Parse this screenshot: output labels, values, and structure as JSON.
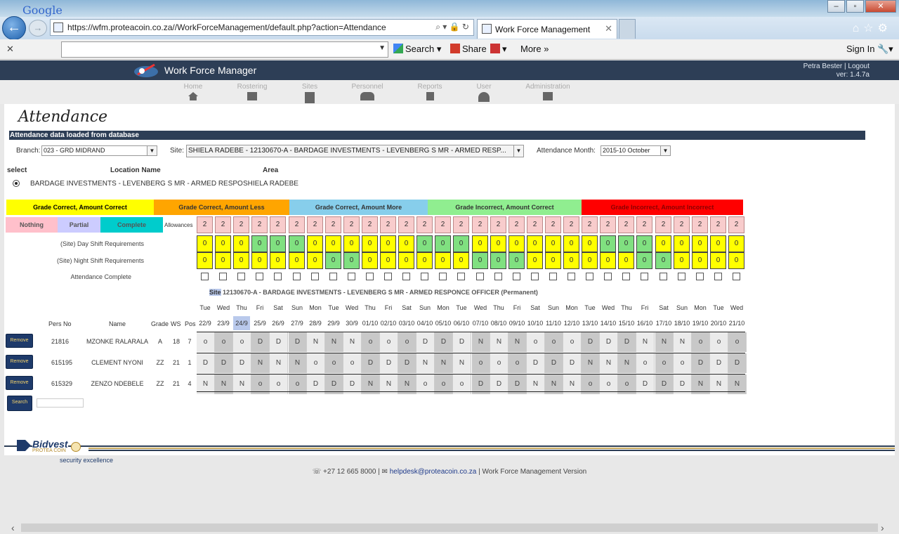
{
  "browser": {
    "url": "https://wfm.proteacoin.co.za//WorkForceManagement/default.php?action=Attendance",
    "tab_title": "Work Force Management"
  },
  "google_bar": {
    "logo": "Google",
    "search_label": "Search",
    "share_label": "Share",
    "more_label": "More",
    "signin_label": "Sign In"
  },
  "app": {
    "title": "Work Force Manager",
    "user_text": "Petra Bester | Logout",
    "version": "ver: 1.4.7a"
  },
  "menu": [
    "Home",
    "Rostering",
    "Sites",
    "Personnel",
    "Reports",
    "User",
    "Administration"
  ],
  "page": {
    "title": "Attendance",
    "status": "Attendance data loaded from database"
  },
  "filters": {
    "branch_label": "Branch:",
    "branch_value": "023 - GRD MIDRAND",
    "site_label": "Site:",
    "site_value": "SHIELA RADEBE - 12130670-A - BARDAGE INVESTMENTS - LEVENBERG S MR - ARMED RESP...",
    "month_label": "Attendance Month:",
    "month_value": "2015-10 October"
  },
  "location_table": {
    "headers": [
      "select",
      "Location Name",
      "Area"
    ],
    "location_name": "BARDAGE INVESTMENTS - LEVENBERG S MR - ARMED RESPO",
    "area": "SHIELA RADEBE"
  },
  "legend": [
    {
      "label": "Grade Correct, Amount Correct",
      "color": "#ffff00",
      "text_color": "#000000"
    },
    {
      "label": "Grade Correct, Amount Less",
      "color": "#ffa500",
      "text_color": "#333333"
    },
    {
      "label": "Grade Correct, Amount More",
      "color": "#87ceeb",
      "text_color": "#333333"
    },
    {
      "label": "Grade Incorrect, Amount Correct",
      "color": "#90ee90",
      "text_color": "#333333"
    },
    {
      "label": "Grade Incorrect, Amount Incorrect",
      "color": "#ff0000",
      "text_color": "#8b0000"
    }
  ],
  "legend2": [
    {
      "label": "Nothing",
      "color": "#ffc0cb"
    },
    {
      "label": "Partial",
      "color": "#ccccff"
    },
    {
      "label": "Complete",
      "color": "#00cccc"
    }
  ],
  "requirement_rows": {
    "allowances_label": "Allowances",
    "day_label": "(Site) Day Shift Requirements",
    "night_label": "(Site) Night Shift Requirements",
    "complete_label": "Attendance Complete"
  },
  "allowances": [
    "2",
    "2",
    "2",
    "2",
    "2",
    "2",
    "2",
    "2",
    "2",
    "2",
    "2",
    "2",
    "2",
    "2",
    "2",
    "2",
    "2",
    "2",
    "2",
    "2",
    "2",
    "2",
    "2",
    "2",
    "2",
    "2",
    "2",
    "2",
    "2",
    "2"
  ],
  "day_req": [
    "0",
    "0",
    "0",
    "0",
    "0",
    "0",
    "0",
    "0",
    "0",
    "0",
    "0",
    "0",
    "0",
    "0",
    "0",
    "0",
    "0",
    "0",
    "0",
    "0",
    "0",
    "0",
    "0",
    "0",
    "0",
    "0",
    "0",
    "0",
    "0",
    "0"
  ],
  "day_colors": [
    "y",
    "y",
    "y",
    "g",
    "g",
    "g",
    "y",
    "y",
    "y",
    "y",
    "y",
    "y",
    "g",
    "g",
    "g",
    "y",
    "y",
    "y",
    "y",
    "y",
    "y",
    "y",
    "g",
    "g",
    "g",
    "y",
    "y",
    "y",
    "y",
    "y"
  ],
  "night_req": [
    "0",
    "0",
    "0",
    "0",
    "0",
    "0",
    "0",
    "0",
    "0",
    "0",
    "0",
    "0",
    "0",
    "0",
    "0",
    "0",
    "0",
    "0",
    "0",
    "0",
    "0",
    "0",
    "0",
    "0",
    "0",
    "0",
    "0",
    "0",
    "0",
    "0"
  ],
  "night_colors": [
    "y",
    "y",
    "y",
    "y",
    "y",
    "y",
    "y",
    "g",
    "g",
    "y",
    "y",
    "y",
    "y",
    "y",
    "y",
    "g",
    "g",
    "g",
    "y",
    "y",
    "y",
    "y",
    "y",
    "y",
    "g",
    "g",
    "y",
    "y",
    "y",
    "y"
  ],
  "site_heading": {
    "prefix": "Site",
    "text": "12130670-A - BARDAGE INVESTMENTS - LEVENBERG S MR - ARMED RESPONCE OFFICER (Permanent)"
  },
  "days": [
    "Tue",
    "Wed",
    "Thu",
    "Fri",
    "Sat",
    "Sun",
    "Mon",
    "Tue",
    "Wed",
    "Thu",
    "Fri",
    "Sat",
    "Sun",
    "Mon",
    "Tue",
    "Wed",
    "Thu",
    "Fri",
    "Sat",
    "Sun",
    "Mon",
    "Tue",
    "Wed",
    "Thu",
    "Fri",
    "Sat",
    "Sun",
    "Mon",
    "Tue",
    "Wed"
  ],
  "dates": [
    "22/9",
    "23/9",
    "24/9",
    "25/9",
    "26/9",
    "27/9",
    "28/9",
    "29/9",
    "30/9",
    "01/10",
    "02/10",
    "03/10",
    "04/10",
    "05/10",
    "06/10",
    "07/10",
    "08/10",
    "09/10",
    "10/10",
    "11/10",
    "12/10",
    "13/10",
    "14/10",
    "15/10",
    "16/10",
    "17/10",
    "18/10",
    "19/10",
    "20/10",
    "21/10"
  ],
  "personnel_headers": {
    "pers_no": "Pers No",
    "name": "Name",
    "grade": "Grade",
    "ws": "WS",
    "pos": "Pos"
  },
  "personnel": [
    {
      "pers_no": "21816",
      "name": "MZONKE RALARALA",
      "grade": "A",
      "ws": "18",
      "pos": "7",
      "shifts": [
        "o",
        "o",
        "o",
        "D",
        "D",
        "D",
        "N",
        "N",
        "N",
        "o",
        "o",
        "o",
        "D",
        "D",
        "D",
        "N",
        "N",
        "N",
        "o",
        "o",
        "o",
        "D",
        "D",
        "D",
        "N",
        "N",
        "N",
        "o",
        "o",
        "o"
      ]
    },
    {
      "pers_no": "615195",
      "name": "CLEMENT NYONI",
      "grade": "ZZ",
      "ws": "21",
      "pos": "1",
      "shifts": [
        "D",
        "D",
        "D",
        "N",
        "N",
        "N",
        "o",
        "o",
        "o",
        "D",
        "D",
        "D",
        "N",
        "N",
        "N",
        "o",
        "o",
        "o",
        "D",
        "D",
        "D",
        "N",
        "N",
        "N",
        "o",
        "o",
        "o",
        "D",
        "D",
        "D"
      ]
    },
    {
      "pers_no": "615329",
      "name": "ZENZO NDEBELE",
      "grade": "ZZ",
      "ws": "21",
      "pos": "4",
      "shifts": [
        "N",
        "N",
        "N",
        "o",
        "o",
        "o",
        "D",
        "D",
        "D",
        "N",
        "N",
        "N",
        "o",
        "o",
        "o",
        "D",
        "D",
        "D",
        "N",
        "N",
        "N",
        "o",
        "o",
        "o",
        "D",
        "D",
        "D",
        "N",
        "N",
        "N"
      ]
    }
  ],
  "buttons": {
    "remove": "Remove",
    "search": "Search"
  },
  "brand": {
    "name": "Bidvest",
    "sub": "PROTEA COIN",
    "tagline": "security excellence"
  },
  "footer": {
    "phone": "+27 12 665 8000 |",
    "email": "helpdesk@proteacoin.co.za",
    "rest": "| Work Force Management Version"
  }
}
